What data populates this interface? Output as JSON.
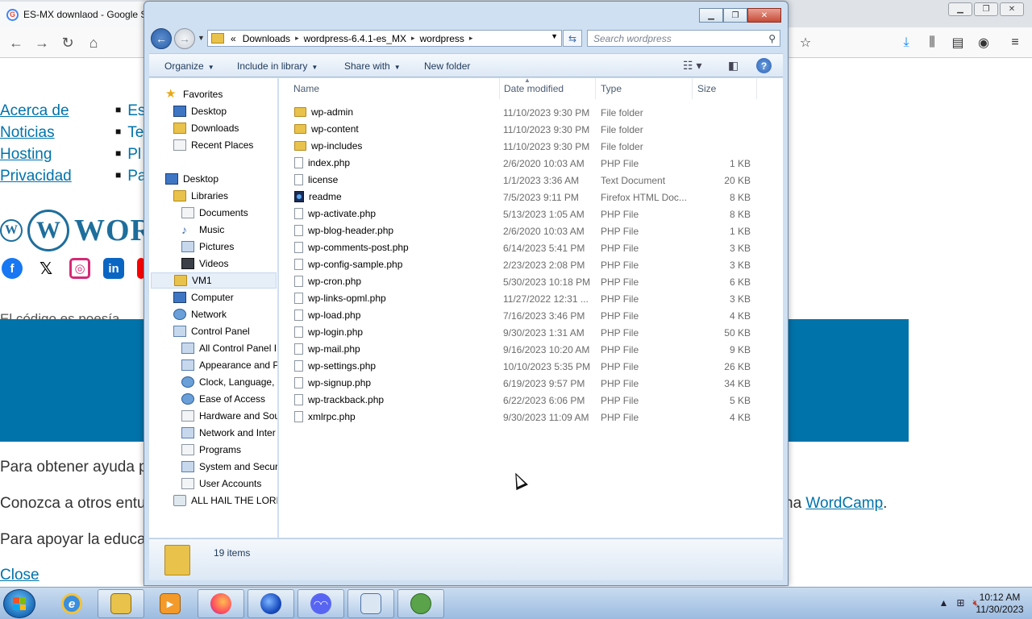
{
  "browser": {
    "tab_title": "ES-MX downlaod - Google S",
    "favicon_letter": "G",
    "window_controls": [
      "▁",
      "❐",
      "✕"
    ],
    "nav_icons": [
      "back-icon",
      "forward-icon",
      "reload-icon",
      "home-icon"
    ],
    "toolbar_icons": [
      "bookmark-star-icon",
      "download-icon",
      "library-icon",
      "sidebar-icon",
      "account-icon",
      "menu-icon"
    ]
  },
  "page": {
    "left_links": [
      "Acerca de",
      "Noticias",
      "Hosting",
      "Privacidad"
    ],
    "bullet_items": [
      "Es",
      "Te",
      "Pl",
      "Pa"
    ],
    "logo_word": "WORD",
    "social_icons": [
      "facebook-icon",
      "x-icon",
      "instagram-icon",
      "linkedin-icon",
      "youtube-icon"
    ],
    "partial_heading": "El código es poesía",
    "text_help": "Para obtener ayuda p",
    "text_meet": "Conozca a otros entu",
    "text_meet_tail_prefix": "na ",
    "text_meet_tail_link": "WordCamp",
    "text_meet_tail_suffix": ".",
    "text_support": "Para apoyar la educa",
    "close_link": "Close",
    "colors": {
      "link": "#0073aa",
      "banner": "#0073aa",
      "logo": "#1e6e9c"
    }
  },
  "explorer": {
    "address": {
      "prefix": "«",
      "segments": [
        "Downloads",
        "wordpress-6.4.1-es_MX",
        "wordpress"
      ]
    },
    "search_placeholder": "Search wordpress",
    "commands": [
      "Organize",
      "Include in library",
      "Share with",
      "New folder"
    ],
    "nav_tree": [
      {
        "label": "Favorites",
        "icon": "star-icon"
      },
      {
        "label": "Desktop",
        "icon": "desktop-icon"
      },
      {
        "label": "Downloads",
        "icon": "downloads-icon"
      },
      {
        "label": "Recent Places",
        "icon": "recent-places-icon"
      },
      {
        "label": "Desktop",
        "icon": "desktop-icon"
      },
      {
        "label": "Libraries",
        "icon": "libraries-icon"
      },
      {
        "label": "Documents",
        "icon": "documents-icon"
      },
      {
        "label": "Music",
        "icon": "music-icon"
      },
      {
        "label": "Pictures",
        "icon": "pictures-icon"
      },
      {
        "label": "Videos",
        "icon": "videos-icon"
      },
      {
        "label": "VM1",
        "icon": "user-folder-icon"
      },
      {
        "label": "Computer",
        "icon": "computer-icon"
      },
      {
        "label": "Network",
        "icon": "network-icon"
      },
      {
        "label": "Control Panel",
        "icon": "control-panel-icon"
      },
      {
        "label": "All Control Panel I",
        "icon": "control-panel-icon"
      },
      {
        "label": "Appearance and P",
        "icon": "appearance-icon"
      },
      {
        "label": "Clock, Language, a",
        "icon": "clock-icon"
      },
      {
        "label": "Ease of Access",
        "icon": "ease-of-access-icon"
      },
      {
        "label": "Hardware and Sou",
        "icon": "hardware-icon"
      },
      {
        "label": "Network and Inter",
        "icon": "network-internet-icon"
      },
      {
        "label": "Programs",
        "icon": "programs-icon"
      },
      {
        "label": "System and Securi",
        "icon": "system-security-icon"
      },
      {
        "label": "User Accounts",
        "icon": "user-accounts-icon"
      },
      {
        "label": "ALL HAIL THE LORD",
        "icon": "recycle-bin-icon"
      }
    ],
    "columns": [
      "Name",
      "Date modified",
      "Type",
      "Size"
    ],
    "files": [
      {
        "name": "wp-admin",
        "date": "11/10/2023 9:30 PM",
        "type": "File folder",
        "size": "",
        "kind": "folder"
      },
      {
        "name": "wp-content",
        "date": "11/10/2023 9:30 PM",
        "type": "File folder",
        "size": "",
        "kind": "folder"
      },
      {
        "name": "wp-includes",
        "date": "11/10/2023 9:30 PM",
        "type": "File folder",
        "size": "",
        "kind": "folder"
      },
      {
        "name": "index.php",
        "date": "2/6/2020 10:03 AM",
        "type": "PHP File",
        "size": "1 KB",
        "kind": "doc"
      },
      {
        "name": "license",
        "date": "1/1/2023 3:36 AM",
        "type": "Text Document",
        "size": "20 KB",
        "kind": "doc"
      },
      {
        "name": "readme",
        "date": "7/5/2023 9:11 PM",
        "type": "Firefox HTML Doc...",
        "size": "8 KB",
        "kind": "firefox"
      },
      {
        "name": "wp-activate.php",
        "date": "5/13/2023 1:05 AM",
        "type": "PHP File",
        "size": "8 KB",
        "kind": "doc"
      },
      {
        "name": "wp-blog-header.php",
        "date": "2/6/2020 10:03 AM",
        "type": "PHP File",
        "size": "1 KB",
        "kind": "doc"
      },
      {
        "name": "wp-comments-post.php",
        "date": "6/14/2023 5:41 PM",
        "type": "PHP File",
        "size": "3 KB",
        "kind": "doc"
      },
      {
        "name": "wp-config-sample.php",
        "date": "2/23/2023 2:08 PM",
        "type": "PHP File",
        "size": "3 KB",
        "kind": "doc"
      },
      {
        "name": "wp-cron.php",
        "date": "5/30/2023 10:18 PM",
        "type": "PHP File",
        "size": "6 KB",
        "kind": "doc"
      },
      {
        "name": "wp-links-opml.php",
        "date": "11/27/2022 12:31 ...",
        "type": "PHP File",
        "size": "3 KB",
        "kind": "doc"
      },
      {
        "name": "wp-load.php",
        "date": "7/16/2023 3:46 PM",
        "type": "PHP File",
        "size": "4 KB",
        "kind": "doc"
      },
      {
        "name": "wp-login.php",
        "date": "9/30/2023 1:31 AM",
        "type": "PHP File",
        "size": "50 KB",
        "kind": "doc"
      },
      {
        "name": "wp-mail.php",
        "date": "9/16/2023 10:20 AM",
        "type": "PHP File",
        "size": "9 KB",
        "kind": "doc"
      },
      {
        "name": "wp-settings.php",
        "date": "10/10/2023 5:35 PM",
        "type": "PHP File",
        "size": "26 KB",
        "kind": "doc"
      },
      {
        "name": "wp-signup.php",
        "date": "6/19/2023 9:57 PM",
        "type": "PHP File",
        "size": "34 KB",
        "kind": "doc"
      },
      {
        "name": "wp-trackback.php",
        "date": "6/22/2023 6:06 PM",
        "type": "PHP File",
        "size": "5 KB",
        "kind": "doc"
      },
      {
        "name": "xmlrpc.php",
        "date": "9/30/2023 11:09 AM",
        "type": "PHP File",
        "size": "4 KB",
        "kind": "doc"
      }
    ],
    "item_count": "19 items"
  },
  "taskbar": {
    "apps": [
      "internet-explorer-icon",
      "windows-explorer-icon",
      "media-player-icon",
      "firefox-icon",
      "firefox-nightly-icon",
      "discord-icon",
      "control-panel-icon",
      "network-icon"
    ],
    "clock_time": "10:12 AM",
    "clock_date": "11/30/2023"
  }
}
